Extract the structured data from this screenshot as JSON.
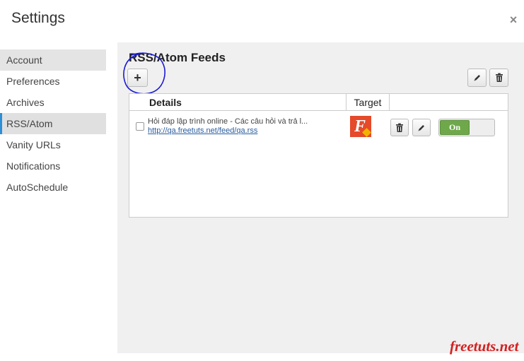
{
  "dialog": {
    "title": "Settings",
    "close_symbol": "×"
  },
  "sidebar": {
    "items": [
      {
        "label": "Account"
      },
      {
        "label": "Preferences"
      },
      {
        "label": "Archives"
      },
      {
        "label": "RSS/Atom"
      },
      {
        "label": "Vanity URLs"
      },
      {
        "label": "Notifications"
      },
      {
        "label": "AutoSchedule"
      }
    ],
    "active": "RSS/Atom"
  },
  "section": {
    "title": "RSS/Atom Feeds",
    "add_label": "+"
  },
  "table": {
    "headers": {
      "details": "Details",
      "target": "Target"
    },
    "rows": [
      {
        "title": "Hỏi đáp lập trình online - Các câu hỏi và trả l...",
        "url": "http://qa.freetuts.net/feed/qa.rss",
        "toggle_label": "On"
      }
    ]
  },
  "icons": {
    "edit": "pencil-icon",
    "delete": "trash-icon",
    "close": "close-icon"
  },
  "colors": {
    "active_accent": "#2d8fd5",
    "toggle_on": "#6fa84a",
    "annotation": "#1a1ad4",
    "watermark": "#d42020",
    "target_logo": "#e54a2a"
  },
  "watermark": "freetuts.net"
}
